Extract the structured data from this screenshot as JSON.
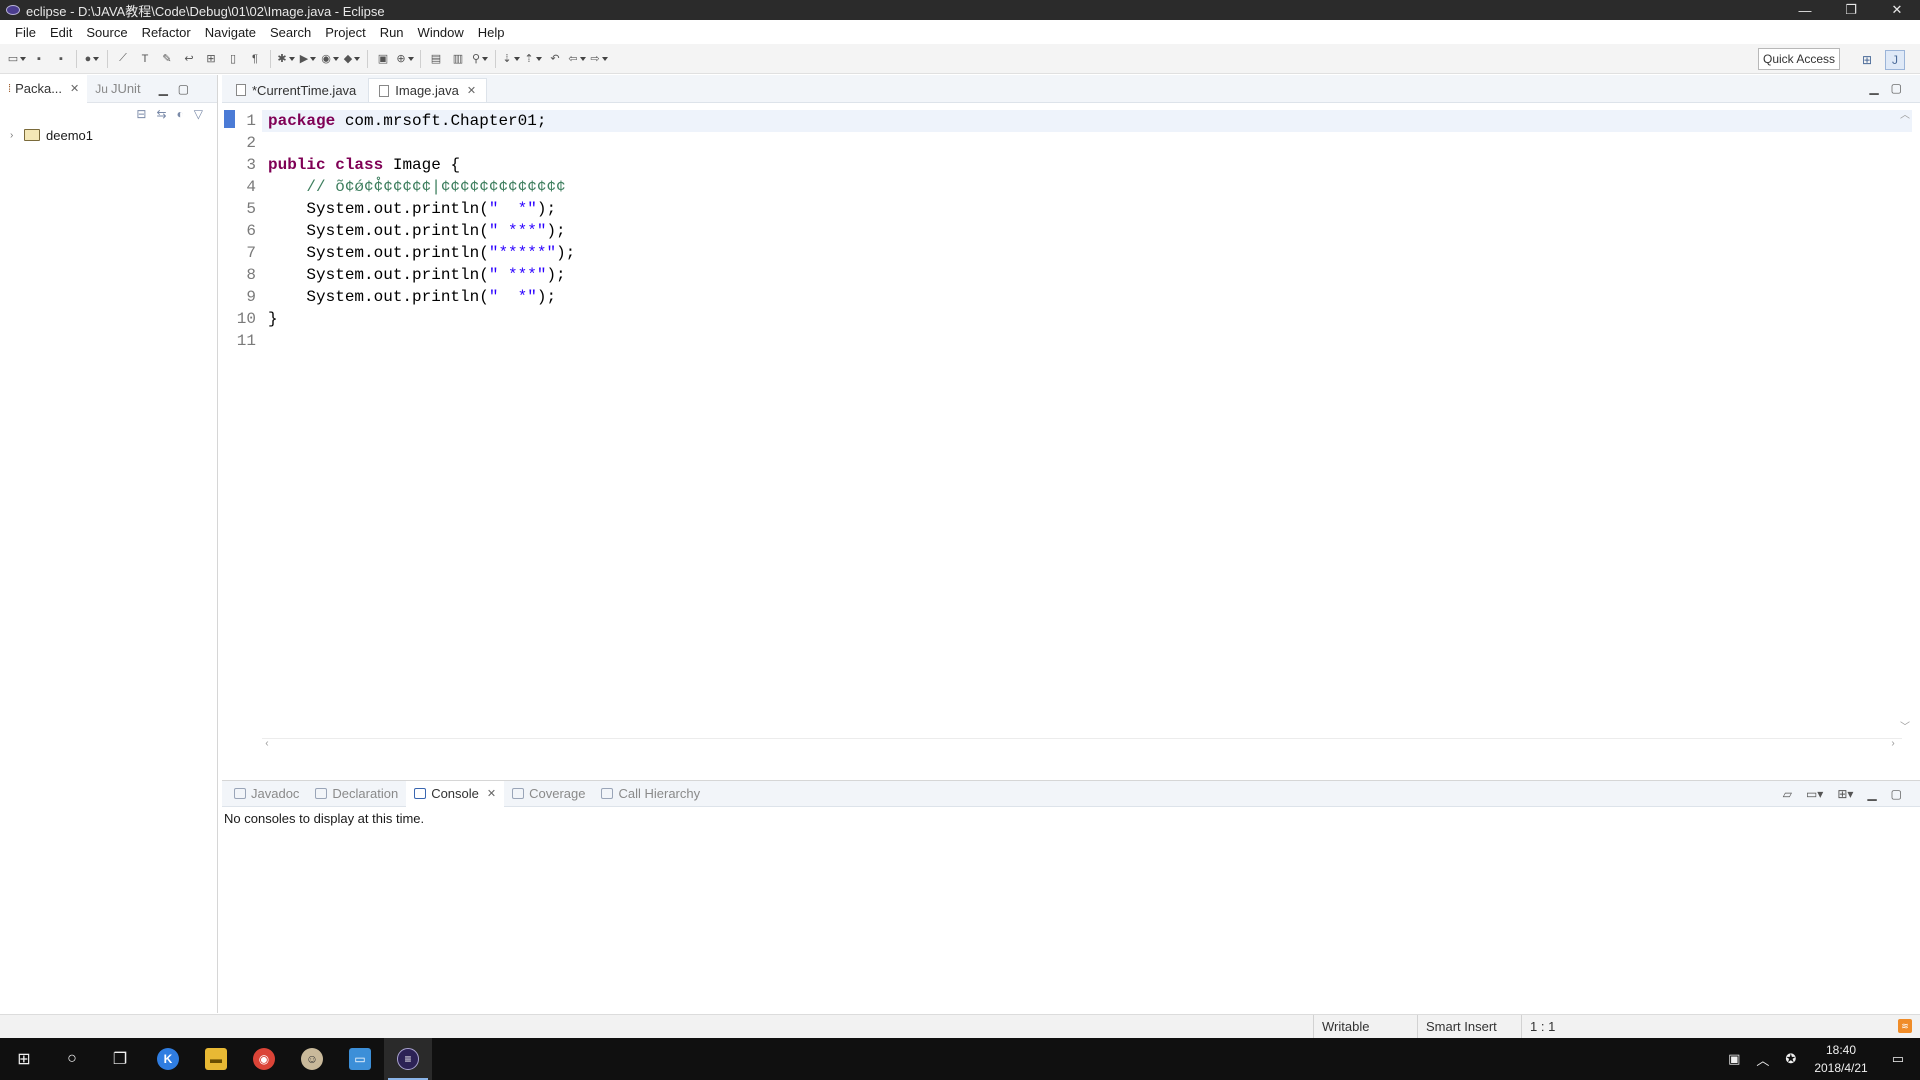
{
  "window": {
    "title": "eclipse - D:\\JAVA教程\\Code\\Debug\\01\\02\\Image.java - Eclipse",
    "minimize": "—",
    "restore": "❐",
    "close": "✕"
  },
  "menu": [
    "File",
    "Edit",
    "Source",
    "Refactor",
    "Navigate",
    "Search",
    "Project",
    "Run",
    "Window",
    "Help"
  ],
  "toolbar": {
    "quick_access": "Quick Access"
  },
  "left_panel": {
    "tabs": [
      {
        "label": "Packa...",
        "active": true
      },
      {
        "label": "JUnit",
        "prefix": "Ju",
        "active": false
      }
    ],
    "tree": [
      {
        "label": "deemo1"
      }
    ]
  },
  "editor": {
    "tabs": [
      {
        "label": "*CurrentTime.java",
        "active": false
      },
      {
        "label": "Image.java",
        "active": true
      }
    ],
    "lines": [
      {
        "no": "1"
      },
      {
        "no": "2"
      },
      {
        "no": "3"
      },
      {
        "no": "4"
      },
      {
        "no": "5"
      },
      {
        "no": "6"
      },
      {
        "no": "7"
      },
      {
        "no": "8"
      },
      {
        "no": "9"
      },
      {
        "no": "10"
      },
      {
        "no": "11"
      }
    ],
    "code": {
      "l1_kw": "package",
      "l1_rest": " com.mrsoft.Chapter01;",
      "l3_kw1": "public",
      "l3_kw2": "class",
      "l3_rest": " Image {",
      "l4_comment": "    // õ¢ǿ¢֯¢¢¢¢¢¢|¢¢¢¢¢¢¢¢¢¢¢¢¢",
      "println_prefix": "    System.out.println(",
      "l5_str": "\"  *\"",
      "l6_str": "\" ***\"",
      "l7_str": "\"*****\"",
      "l8_str": "\" ***\"",
      "l9_str": "\"  *\"",
      "println_suffix": ");",
      "l10": "}"
    }
  },
  "bottom_panel": {
    "tabs": [
      {
        "label": "Javadoc",
        "active": false
      },
      {
        "label": "Declaration",
        "active": false
      },
      {
        "label": "Console",
        "active": true
      },
      {
        "label": "Coverage",
        "active": false
      },
      {
        "label": "Call Hierarchy",
        "active": false
      }
    ],
    "console_message": "No consoles to display at this time."
  },
  "status": {
    "writable": "Writable",
    "insert_mode": "Smart Insert",
    "position": "1 : 1"
  },
  "taskbar": {
    "time": "18:40",
    "date": "2018/4/21"
  },
  "colors": {
    "keyword": "#7f0055",
    "string": "#2a00ff",
    "comment": "#3f7f5f",
    "accent": "#4b7bd6"
  }
}
